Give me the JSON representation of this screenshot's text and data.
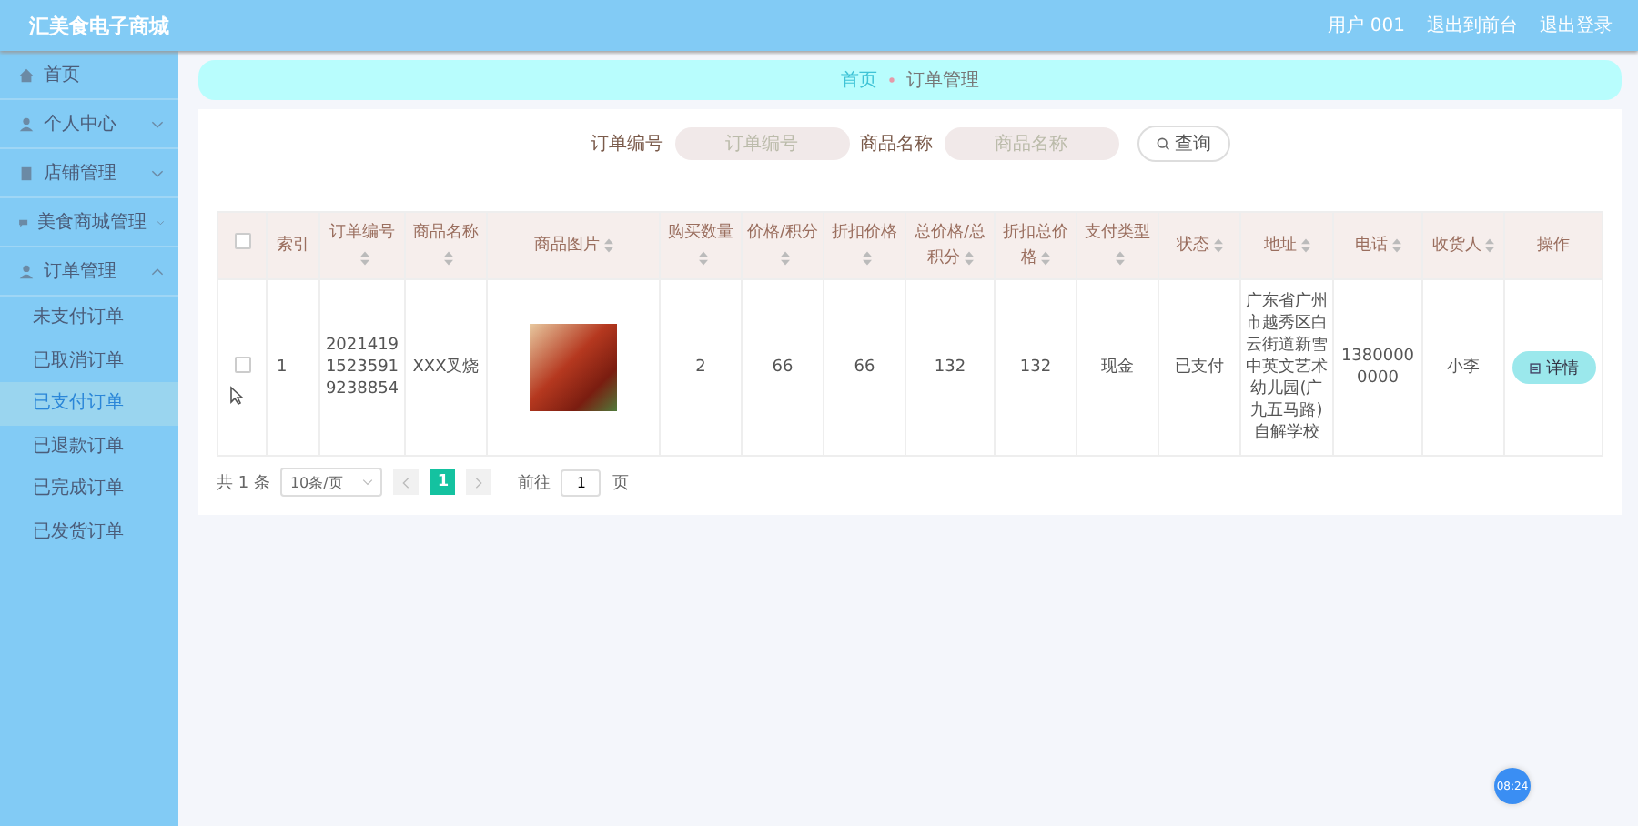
{
  "header": {
    "title": "汇美食电子商城",
    "user": "用户 001",
    "links": [
      "退出到前台",
      "退出登录"
    ]
  },
  "sidebar": {
    "items": [
      {
        "label": "首页"
      },
      {
        "label": "个人中心",
        "expanded": false
      },
      {
        "label": "店铺管理",
        "expanded": false
      },
      {
        "label": "美食商城管理",
        "expanded": false
      },
      {
        "label": "订单管理",
        "expanded": true,
        "children": [
          {
            "label": "未支付订单",
            "selected": false
          },
          {
            "label": "已取消订单",
            "selected": false
          },
          {
            "label": "已支付订单",
            "selected": true
          },
          {
            "label": "已退款订单",
            "selected": false
          },
          {
            "label": "已完成订单",
            "selected": false
          },
          {
            "label": "已发货订单",
            "selected": false
          }
        ]
      }
    ]
  },
  "breadcrumb": [
    "首页",
    "订单管理"
  ],
  "search": {
    "fields": [
      {
        "label": "订单编号",
        "placeholder": "订单编号"
      },
      {
        "label": "商品名称",
        "placeholder": "商品名称"
      }
    ],
    "button": "查询"
  },
  "table": {
    "select_all_checked": false,
    "columns": [
      {
        "label": "索引",
        "sortable": false
      },
      {
        "label": "订单编号",
        "sortable": true
      },
      {
        "label": "商品名称",
        "sortable": true
      },
      {
        "label": "商品图片",
        "sortable": true
      },
      {
        "label": "购买数量",
        "sortable": true
      },
      {
        "label": "价格/积分",
        "sortable": true
      },
      {
        "label": "折扣价格",
        "sortable": true
      },
      {
        "label": "总价格/总积分",
        "sortable": true
      },
      {
        "label": "折扣总价格",
        "sortable": true
      },
      {
        "label": "支付类型",
        "sortable": true
      },
      {
        "label": "状态",
        "sortable": true
      },
      {
        "label": "地址",
        "sortable": true
      },
      {
        "label": "电话",
        "sortable": true
      },
      {
        "label": "收货人",
        "sortable": true
      },
      {
        "label": "操作",
        "sortable": false
      }
    ],
    "rows": [
      {
        "checked": false,
        "cells": [
          "1",
          "202141915235919238854",
          "XXX叉烧",
          null,
          "2",
          "66",
          "66",
          "132",
          "132",
          "现金",
          "已支付",
          "广东省广州市越秀区白云街道新雪中英文艺术幼儿园(广九五马路)自解学校",
          "13800000000",
          "小李"
        ],
        "action": "详情"
      }
    ]
  },
  "pagination": {
    "total": "共 1 条",
    "page_size": "10条/页",
    "pages": [
      {
        "label": "1",
        "selected": true
      }
    ],
    "goto_label": "前往",
    "goto_value": "1",
    "goto_suffix": "页"
  },
  "clock": "08:24"
}
